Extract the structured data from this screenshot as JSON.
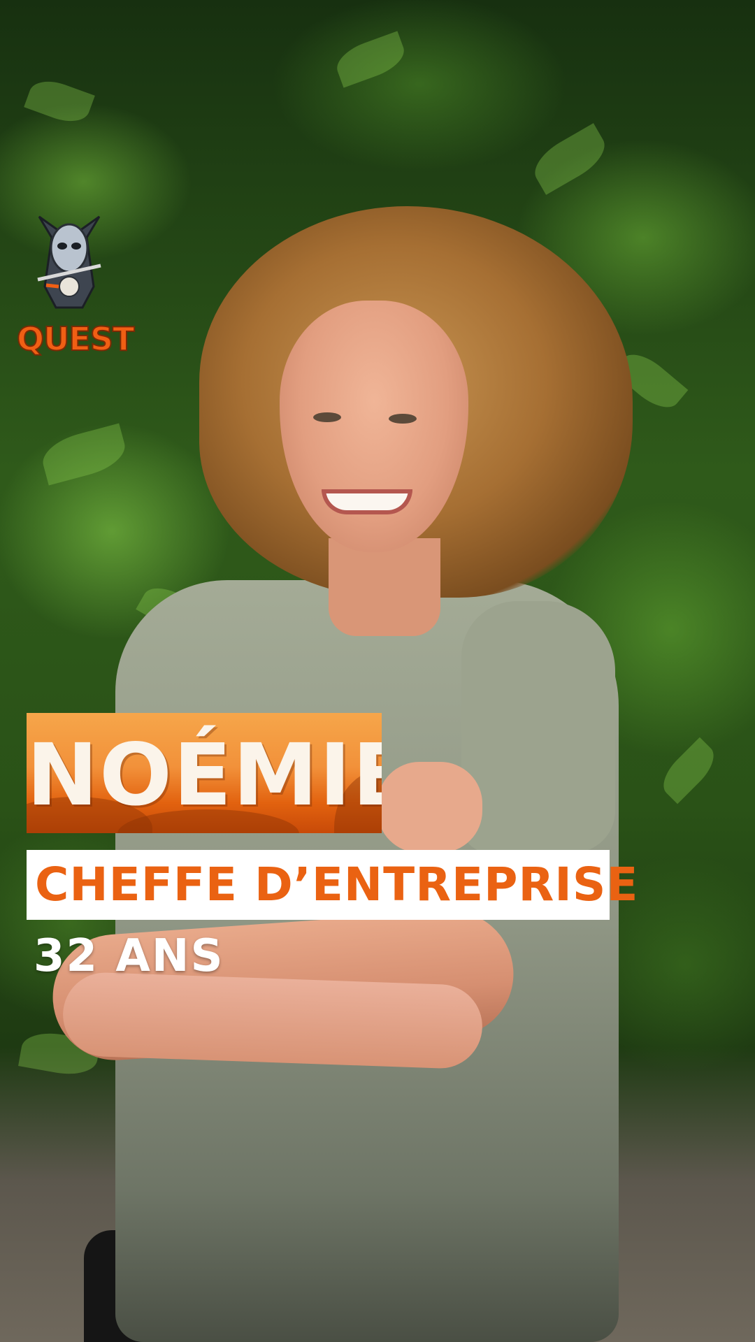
{
  "logo": {
    "text": "QUEST",
    "icon": "tribal-mask-icon",
    "color": "#f05f14"
  },
  "candidate": {
    "name": "NOÉMIE",
    "occupation": "CHEFFE D’ENTREPRISE",
    "age": "32 ANS"
  },
  "colors": {
    "accent": "#ea6212",
    "banner": "#f2913a",
    "label_bg": "#ffffff"
  }
}
